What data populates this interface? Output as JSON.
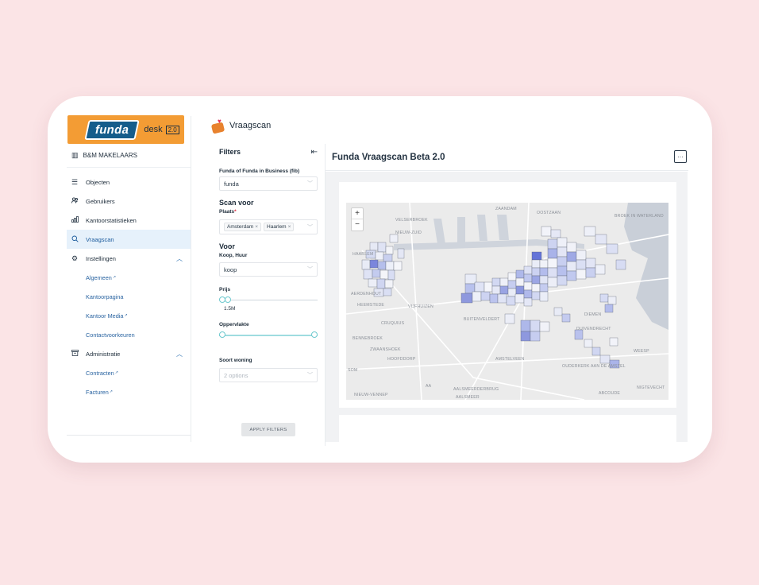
{
  "colors": {
    "background": "#fbe4e6",
    "brand_orange": "#f39c34",
    "brand_blue": "#155d8b",
    "active_nav_bg": "#e6f1fb",
    "link": "#2a64a1",
    "heat_low": "#e4e8f6",
    "heat_high": "#6474d8",
    "water": "#c9cfd8"
  },
  "sidebar": {
    "logo": {
      "brand": "funda",
      "product": "desk",
      "version": "2.0"
    },
    "office_icon": "building-icon",
    "office": "B&M MAKELAARS",
    "items": [
      {
        "label": "Objecten",
        "icon": "list-icon",
        "active": false
      },
      {
        "label": "Gebruikers",
        "icon": "users-icon",
        "active": false
      },
      {
        "label": "Kantoorstatistieken",
        "icon": "bar-chart-icon",
        "active": false
      },
      {
        "label": "Vraagscan",
        "icon": "search-icon",
        "active": true
      },
      {
        "label": "Instellingen",
        "icon": "gear-icon",
        "active": false,
        "expanded": true,
        "children": [
          "Algemeen",
          "Kantoorpagina",
          "Kantoor Media",
          "Contactvoorkeuren"
        ]
      },
      {
        "label": "Administratie",
        "icon": "archive-icon",
        "active": false,
        "expanded": true,
        "children": [
          "Contracten",
          "Facturen"
        ]
      }
    ],
    "external_marker": "↗"
  },
  "header": {
    "title": "Vraagscan",
    "icon": "shopping-bag-heart-icon"
  },
  "filters": {
    "title": "Filters",
    "source": {
      "label": "Funda of Funda in Business (fib)",
      "value": "funda"
    },
    "scan_voor": {
      "heading": "Scan voor",
      "label": "Plaats",
      "required": "*",
      "tags": [
        "Amsterdam",
        "Haarlem"
      ]
    },
    "voor": {
      "heading": "Voor",
      "label": "Koop, Huur",
      "value": "koop"
    },
    "prijs": {
      "label": "Prijs",
      "value": "1.5M"
    },
    "oppervlakte": {
      "label": "Oppervlakte"
    },
    "soort": {
      "label": "Soort woning",
      "placeholder": "2 options"
    },
    "apply": "APPLY FILTERS"
  },
  "main": {
    "title": "Funda Vraagscan Beta 2.0",
    "more": "···",
    "zoom_in": "+",
    "zoom_out": "−",
    "map_labels": [
      "ZAANDAM",
      "OOSTZAAN",
      "BROEK IN WATERLAND",
      "VELSERBROEK",
      "NIEUW-ZUID",
      "HAARLEM",
      "AERDENHOUT",
      "HEEMSTEDE",
      "VIJFHUIZEN",
      "CRUQUIUS",
      "BUITENVELDERT",
      "BENNEBROEK",
      "ZWAANSHOEK",
      "HOOFDDORP",
      "AMSTELVEEN",
      "DUIVENDRECHT",
      "DIEMEN",
      "WEESP",
      "OUDERKERK AAN DE AMSTEL",
      "SOM",
      "AALSMEERDERBRUG",
      "AALSMEER",
      "NIEUW-VENNEP",
      "ABCOUDE",
      "NIGTEVECHT",
      "AA"
    ]
  }
}
